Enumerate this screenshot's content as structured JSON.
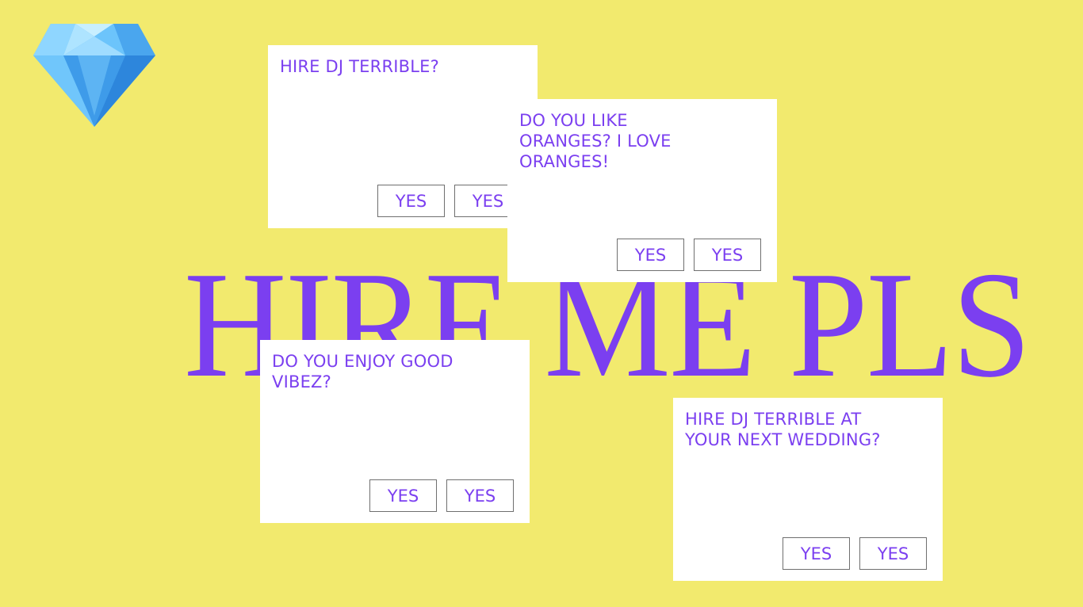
{
  "brand": {
    "logo_icon": "gem-icon",
    "logo_colors": [
      "#6cc9ff",
      "#3a97e8",
      "#bfe9ff"
    ]
  },
  "headline": "HIRE ME PLS",
  "colors": {
    "background": "#f2ea6e",
    "accent": "#7b3ff0",
    "dialog_background": "#ffffff",
    "button_border": "#6f6f6f"
  },
  "dialogs": [
    {
      "question": "HIRE DJ TERRIBLE?",
      "buttons": [
        "YES",
        "YES"
      ]
    },
    {
      "question": "DO YOU LIKE ORANGES? I LOVE ORANGES!",
      "buttons": [
        "YES",
        "YES"
      ]
    },
    {
      "question": "DO YOU ENJOY GOOD VIBEZ?",
      "buttons": [
        "YES",
        "YES"
      ]
    },
    {
      "question": "HIRE DJ TERRIBLE AT YOUR NEXT WEDDING?",
      "buttons": [
        "YES",
        "YES"
      ]
    }
  ]
}
